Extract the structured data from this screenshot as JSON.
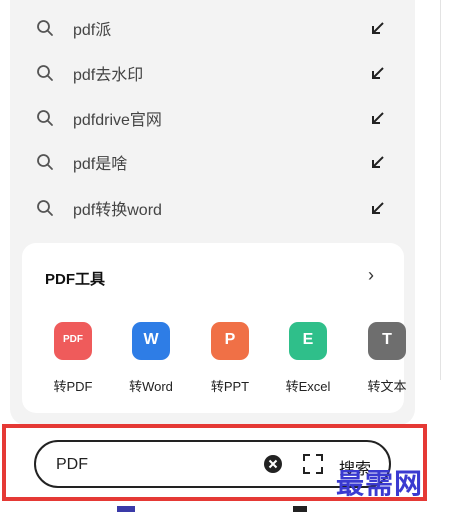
{
  "suggestions": [
    {
      "text": "pdf派"
    },
    {
      "text": "pdf去水印"
    },
    {
      "text": "pdfdrive官网"
    },
    {
      "text": "pdf是啥"
    },
    {
      "text": "pdf转换word"
    }
  ],
  "tools_card": {
    "title": "PDF工具",
    "more": "›",
    "tools": [
      {
        "label": "转PDF",
        "icon": "pdf-icon",
        "icon_text": "PDF",
        "color": "#ef5b5b"
      },
      {
        "label": "转Word",
        "icon": "word-icon",
        "icon_text": "W",
        "color": "#2e7de6"
      },
      {
        "label": "转PPT",
        "icon": "ppt-icon",
        "icon_text": "P",
        "color": "#f07046"
      },
      {
        "label": "转Excel",
        "icon": "excel-icon",
        "icon_text": "E",
        "color": "#2fbf8a"
      },
      {
        "label": "转文本",
        "icon": "text-icon",
        "icon_text": "T",
        "color": "#6e6e6e"
      }
    ]
  },
  "search": {
    "value": "PDF",
    "button": "搜索"
  },
  "watermark": "最需网",
  "colors": {
    "highlight": "#e53935",
    "watermark": "#3a3ad0"
  }
}
